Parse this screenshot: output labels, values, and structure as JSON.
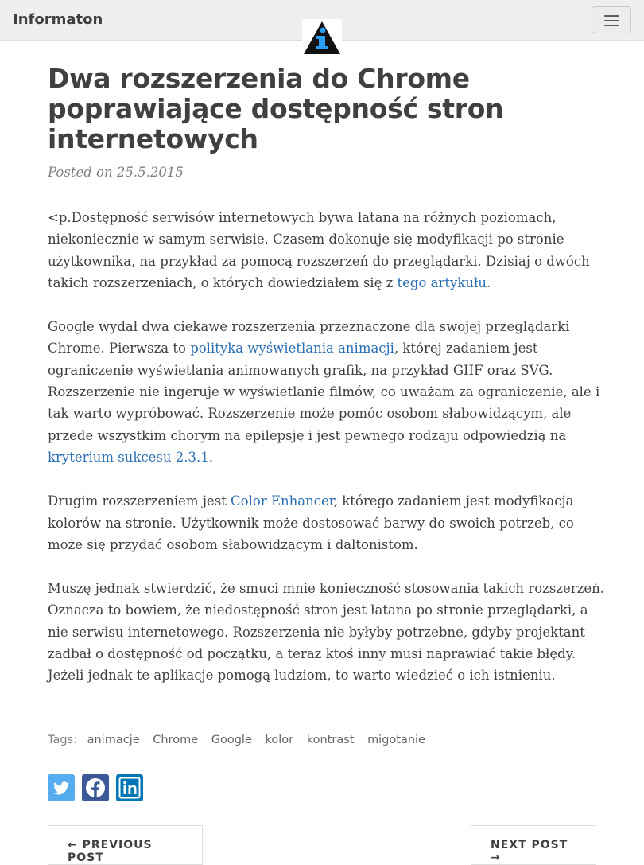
{
  "navbar": {
    "brand": "Informaton",
    "menu_toggle_label": "Toggle navigation"
  },
  "post": {
    "title": "Dwa rozszerzenia do Chrome poprawiające dostępność stron internetowych",
    "posted": "Posted on 25.5.2015",
    "paragraphs": [
      {
        "before": "<p.Dostępność serwisów internetowych bywa łatana na różnych poziomach, niekoniecznie w samym serwisie. Czasem dokonuje się modyfikacji po stronie użytkownika, na przykład za pomocą rozszerzeń do przeglądarki. Dzisiaj o dwóch takich rozszerzeniach, o których dowiedziałem się z ",
        "link": "tego artykułu.",
        "after": ""
      },
      {
        "before": "Google wydał dwa ciekawe rozszerzenia przeznaczone dla swojej przeglądarki Chrome. Pierwsza to ",
        "link": "polityka wyświetlania animacji",
        "middle": ", której zadaniem jest ograniczenie wyświetlania animowanych grafik, na przykład GIIF oraz SVG. Rozszerzenie nie ingeruje w wyświetlanie filmów, co uważam za ograniczenie, ale i tak warto wypróbować. Rozszerzenie może pomóc osobom słabowidzącym, ale przede wszystkim chorym na epilepsję i jest pewnego rodzaju odpowiedzią na ",
        "link2": "kryterium sukcesu 2.3.1",
        "after": "."
      },
      {
        "before": "Drugim rozszerzeniem jest ",
        "link": "Color Enhancer",
        "after": ", którego zadaniem jest modyfikacja kolorów na stronie. Użytkownik może dostosować barwy do swoich potrzeb, co może się przydać osobom słabowidzącym i daltonistom."
      },
      {
        "text": "Muszę jednak stwierdzić, że smuci mnie konieczność stosowania takich rozszerzeń. Oznacza to bowiem, że niedostępność stron jest łatana po stronie przeglądarki, a nie serwisu internetowego. Rozszerzenia nie byłyby potrzebne, gdyby projektant zadbał o dostępność od początku, a teraz ktoś inny musi naprawiać takie błędy. Jeżeli jednak te aplikacje pomogą ludziom, to warto wiedzieć o ich istnieniu."
      }
    ]
  },
  "tags": {
    "label": "Tags:",
    "items": [
      "animacje",
      "Chrome",
      "Google",
      "kolor",
      "kontrast",
      "migotanie"
    ]
  },
  "share": {
    "icons": [
      "twitter-icon",
      "facebook-icon",
      "linkedin-icon"
    ],
    "colors": {
      "twitter": "#55acee",
      "facebook": "#3b5998",
      "linkedin": "#0077b5"
    }
  },
  "pager": {
    "previous": "← Previous Post",
    "next": "Next Post →"
  },
  "colors": {
    "navbar_bg": "#efefef",
    "text": "#404040",
    "muted": "#808080",
    "link": "#2a6fb4",
    "logo_blue": "#2a9df4"
  }
}
